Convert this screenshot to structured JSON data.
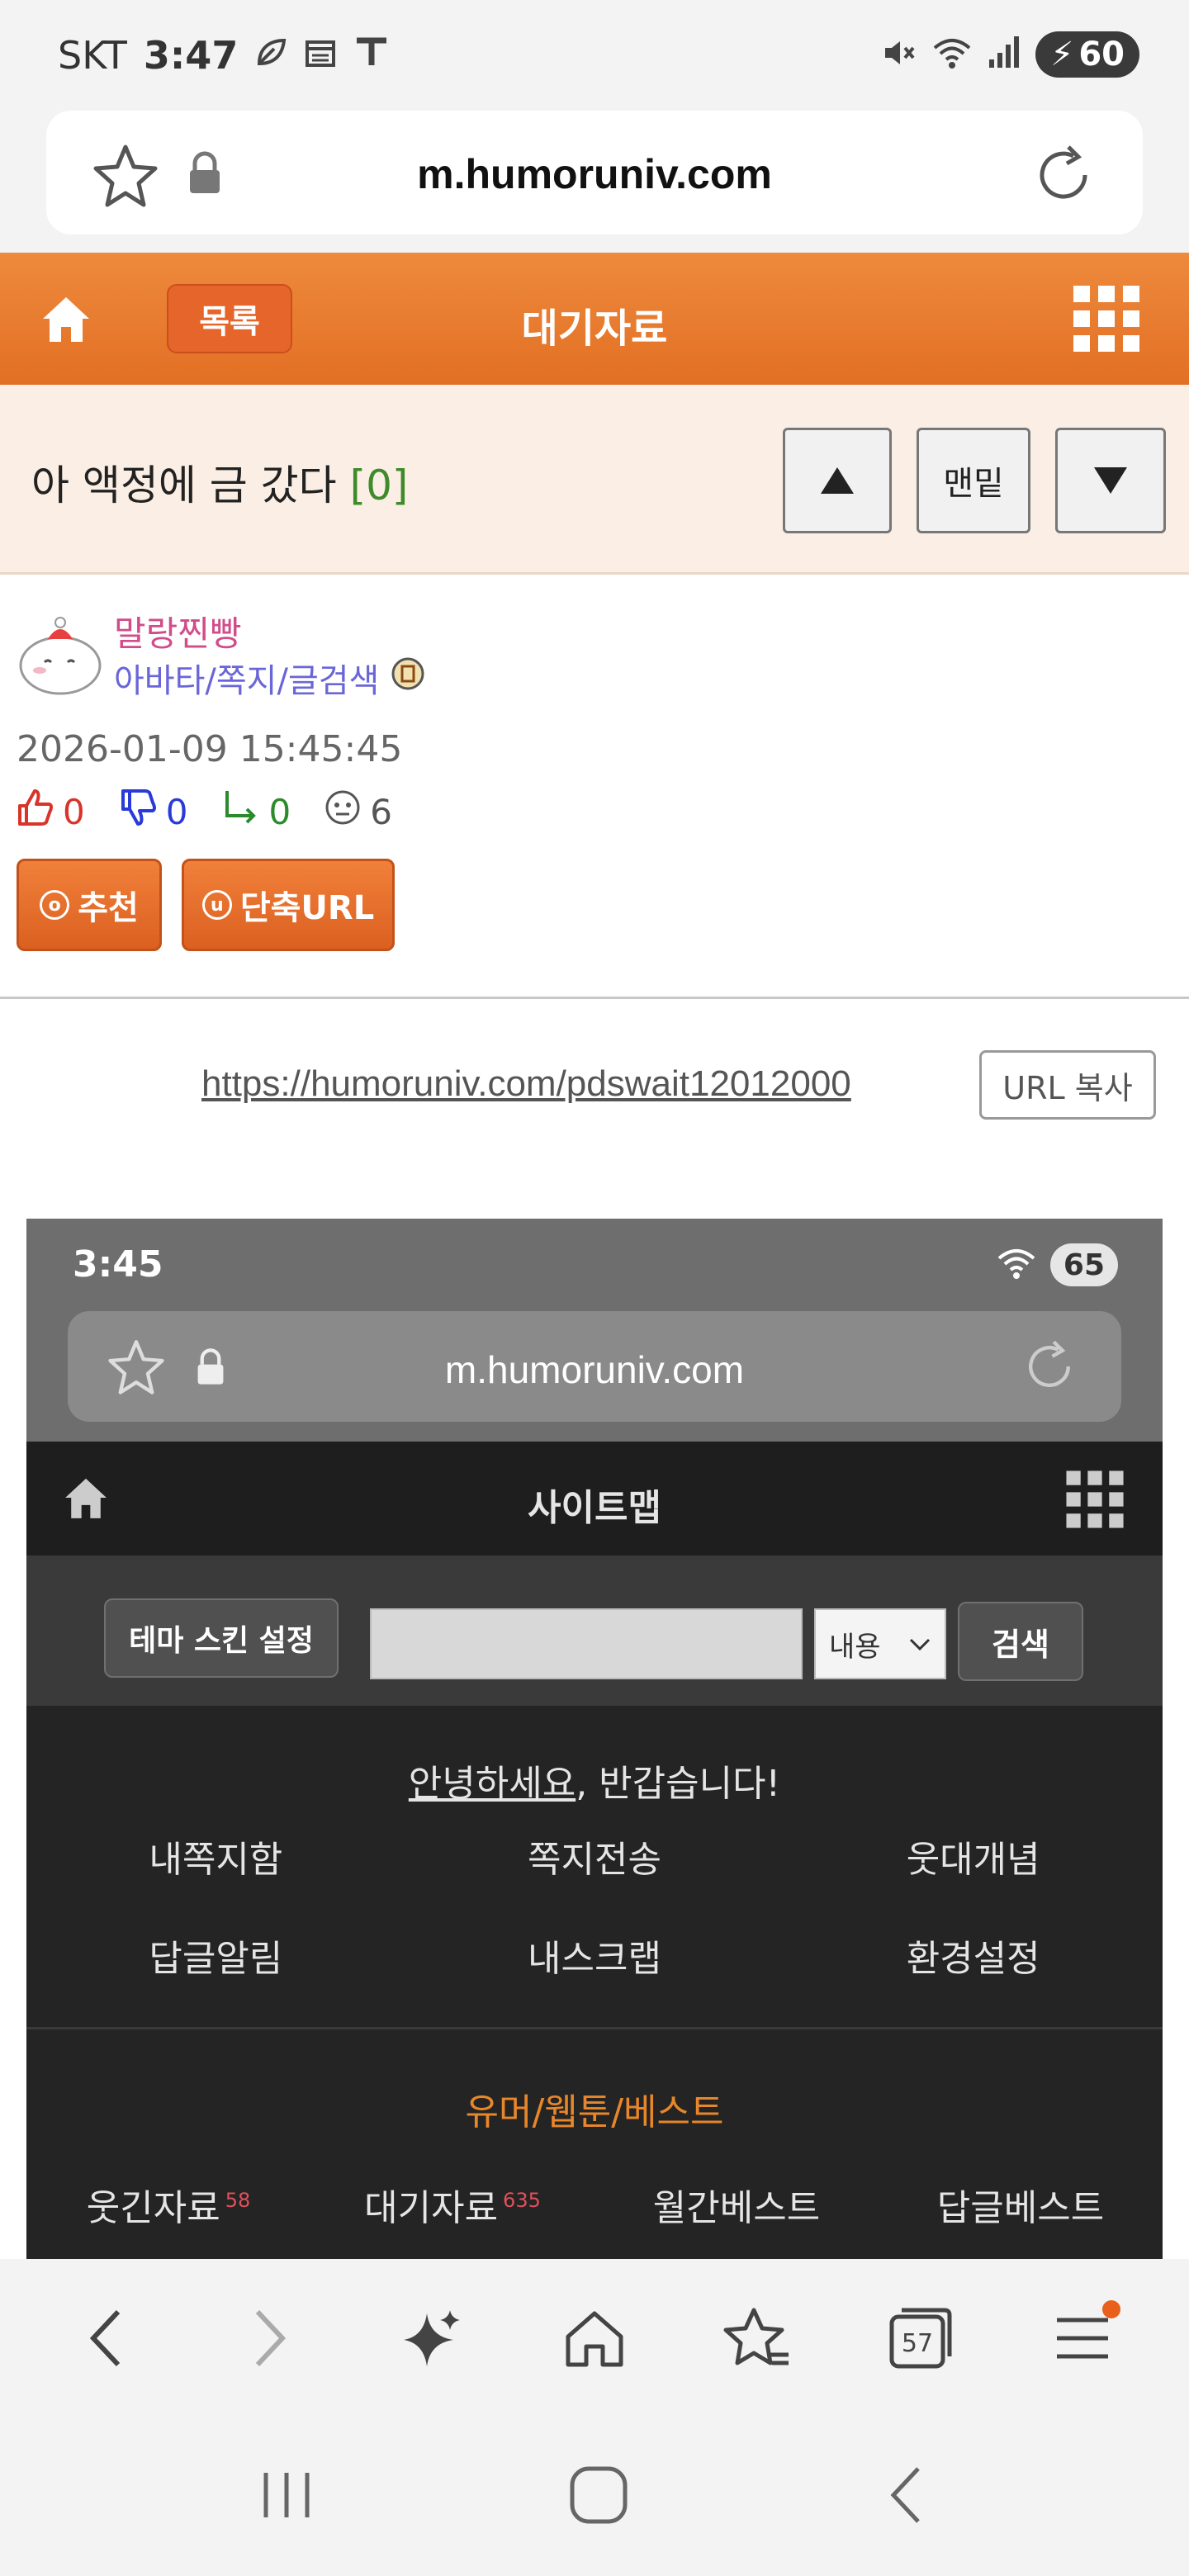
{
  "status_bar": {
    "carrier": "SKT",
    "time": "3:47",
    "battery": "60"
  },
  "address_bar": {
    "url": "m.humoruniv.com"
  },
  "header": {
    "list_label": "목록",
    "title": "대기자료"
  },
  "post": {
    "title": "아 액정에 금 갔다",
    "comment_count": "[0]",
    "nav_bottom_label": "맨밑"
  },
  "author": {
    "nickname": "말랑찐빵",
    "links": "아바타/쪽지/글검색",
    "date": "2026-01-09 15:45:45",
    "likes": "0",
    "dislikes": "0",
    "replies": "0",
    "views": "6",
    "recommend_label": "추천",
    "recommend_icon": "o",
    "shorturl_label": "단축URL",
    "shorturl_icon": "u"
  },
  "url_row": {
    "url": "https://humoruniv.com/pdswait12012000",
    "copy_label": "URL 복사"
  },
  "embedded_screenshot": {
    "time": "3:45",
    "battery": "65",
    "url": "m.humoruniv.com",
    "nav_title": "사이트맵",
    "theme_button": "테마 스킨 설정",
    "select_value": "내용",
    "search_button": "검색",
    "greeting_link": "안녕하세요",
    "greeting_rest": ", 반갑습니다!",
    "menu_items": [
      "내쪽지함",
      "쪽지전송",
      "웃대개념",
      "답글알림",
      "내스크랩",
      "환경설정"
    ],
    "section_title": "유머/웹툰/베스트",
    "section_links": [
      {
        "label": "웃긴자료",
        "count": "58"
      },
      {
        "label": "대기자료",
        "count": "635"
      },
      {
        "label": "월간베스트",
        "count": ""
      },
      {
        "label": "답글베스트",
        "count": ""
      }
    ]
  },
  "toolbar": {
    "tabs_count": "57"
  },
  "colors": {
    "header_orange": "#e26f24",
    "nickname_pink": "#d04c8a",
    "link_purple": "#6a66d8",
    "count_green": "#3f8a2a",
    "section_orange": "#e8862a"
  }
}
